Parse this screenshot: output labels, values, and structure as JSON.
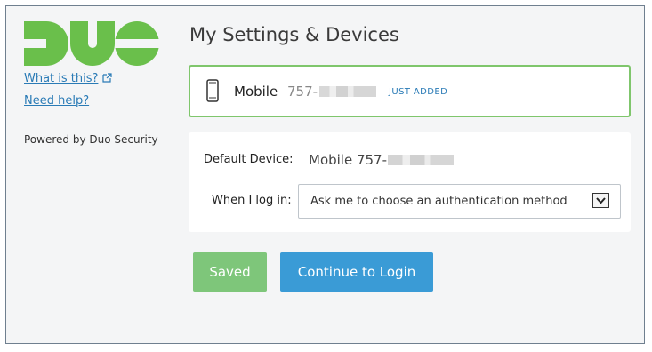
{
  "sidebar": {
    "logo_text": "DUO",
    "what_is_this": "What is this?",
    "need_help": "Need help?",
    "powered_by": "Powered by Duo Security"
  },
  "main": {
    "title": "My Settings & Devices",
    "device": {
      "name": "Mobile",
      "number_prefix": "757-",
      "badge": "JUST ADDED"
    },
    "settings": {
      "default_device_label": "Default Device:",
      "default_device_value": "Mobile 757-",
      "login_label": "When I log in:",
      "login_select_value": "Ask me to choose an authentication method"
    },
    "buttons": {
      "saved": "Saved",
      "continue": "Continue to Login"
    }
  },
  "colors": {
    "brand_green": "#6abf4b",
    "card_border_green": "#7fc66c",
    "link_blue": "#2a7bb6",
    "continue_blue": "#3a9bd6",
    "saved_green": "#7ec67a"
  },
  "icons": [
    "duo-logo",
    "external-link-icon",
    "mobile-phone-icon",
    "chevron-down-icon"
  ]
}
